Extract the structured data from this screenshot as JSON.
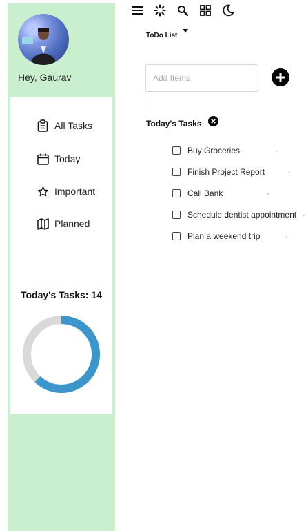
{
  "user": {
    "greeting": "Hey, Gaurav"
  },
  "sidebar": {
    "items": [
      {
        "label": "All Tasks",
        "icon": "clipboard-icon"
      },
      {
        "label": "Today",
        "icon": "calendar-icon"
      },
      {
        "label": "Important",
        "icon": "star-icon"
      },
      {
        "label": "Planned",
        "icon": "map-icon"
      }
    ],
    "tasks_summary": {
      "label": "Today's Tasks:",
      "count": "14",
      "progress": 0.62
    }
  },
  "toolbar": {
    "icons": [
      "menu-icon",
      "loading-icon",
      "search-icon",
      "grid-icon",
      "theme-toggle-icon"
    ]
  },
  "list_select": {
    "value": "ToDo List"
  },
  "add_item": {
    "placeholder": "Add Items"
  },
  "section": {
    "title": "Today's Tasks"
  },
  "tasks": [
    "Buy Groceries",
    "Finish Project Report",
    "Call Bank",
    "Schedule dentist appointment",
    "Plan a weekend trip"
  ],
  "colors": {
    "sidebar_bg": "#c9efcf",
    "progress": "#3c96cc",
    "track": "#d9d9d9"
  }
}
